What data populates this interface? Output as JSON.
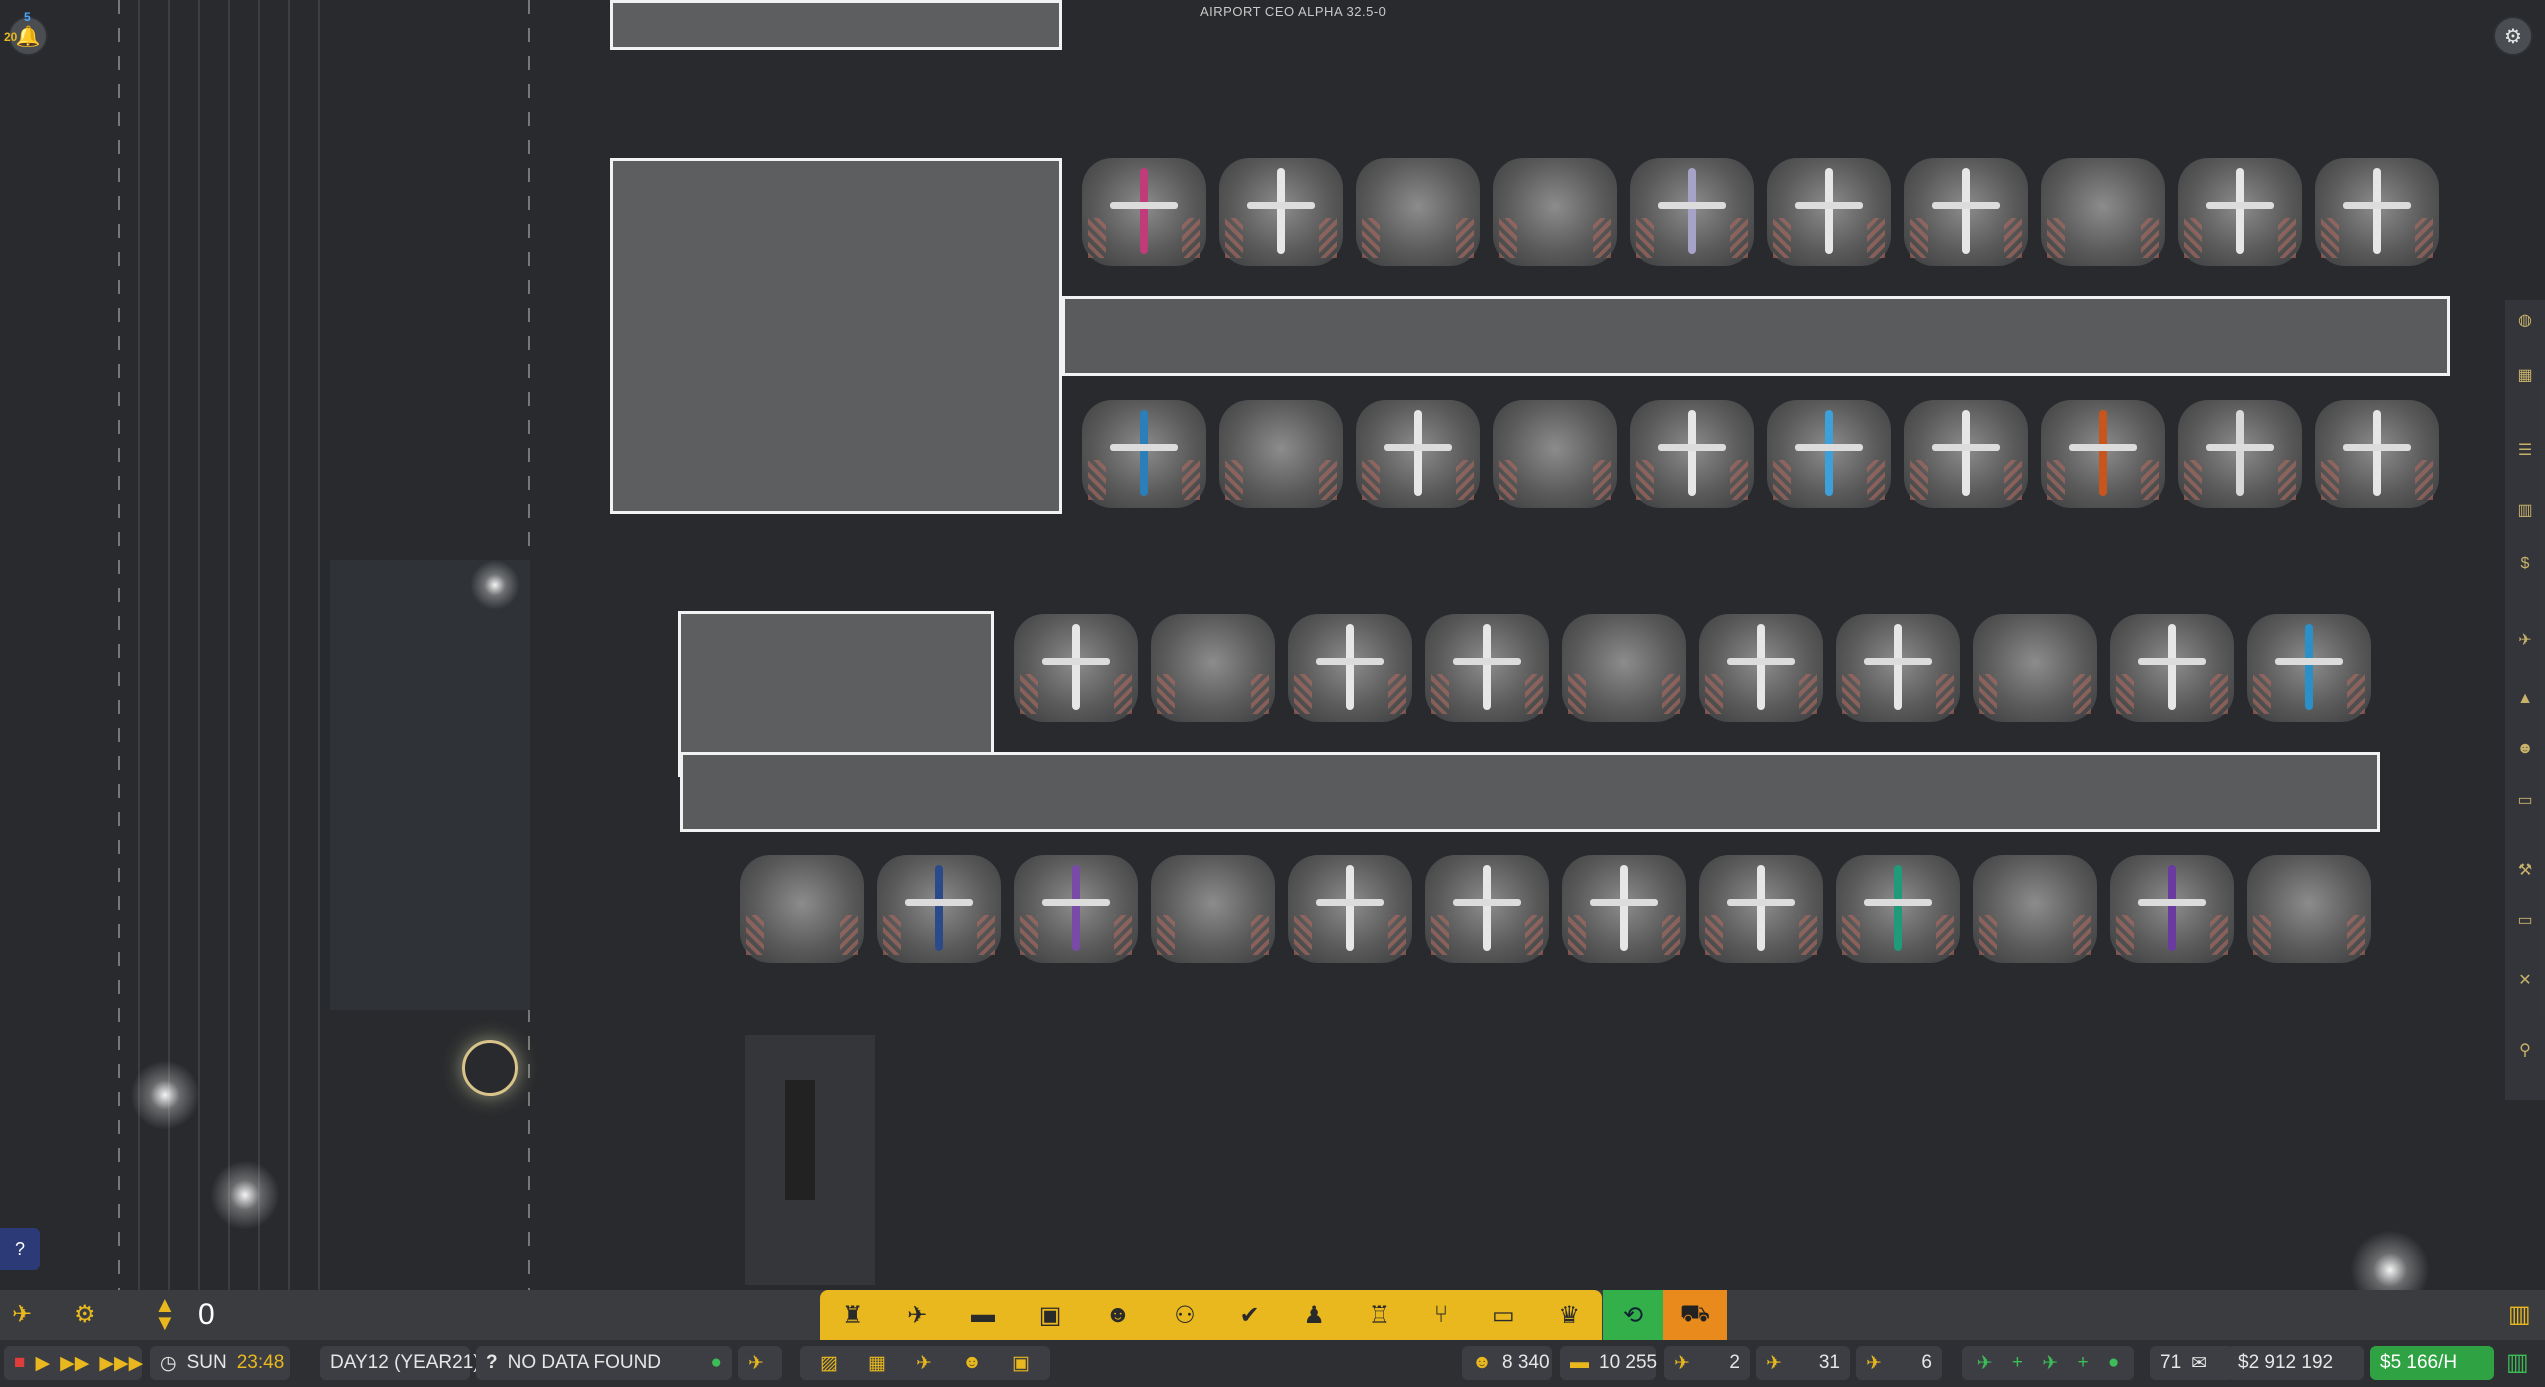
{
  "app": {
    "version": "AIRPORT CEO ALPHA 32.5-0"
  },
  "notifications": {
    "count_top": "5",
    "count_left": "20"
  },
  "help": {
    "label": "?"
  },
  "topbar_left": {
    "departures_icon": "departures-icon",
    "settings_icon": "gear-icon",
    "stepper_value": "0"
  },
  "build_menu": {
    "items": [
      "control-tower",
      "airplane",
      "bus",
      "baggage",
      "staff",
      "security",
      "check-in",
      "restroom",
      "podium",
      "food",
      "seating",
      "shops"
    ]
  },
  "time": {
    "day": "SUN",
    "clock": "23:48",
    "date": "DAY12 (YEAR21)"
  },
  "status": {
    "message": "NO DATA FOUND"
  },
  "stats": {
    "passengers": "8 340",
    "cars": "10 255",
    "arrivals": "2",
    "stands": "31",
    "departures": "6",
    "mail": "71",
    "money": "$2 912 192",
    "rate": "$5 166/H"
  },
  "colors": {
    "accent": "#e8b81e",
    "green": "#33b04a",
    "orange": "#e98a1c",
    "bg": "#282a2d"
  }
}
